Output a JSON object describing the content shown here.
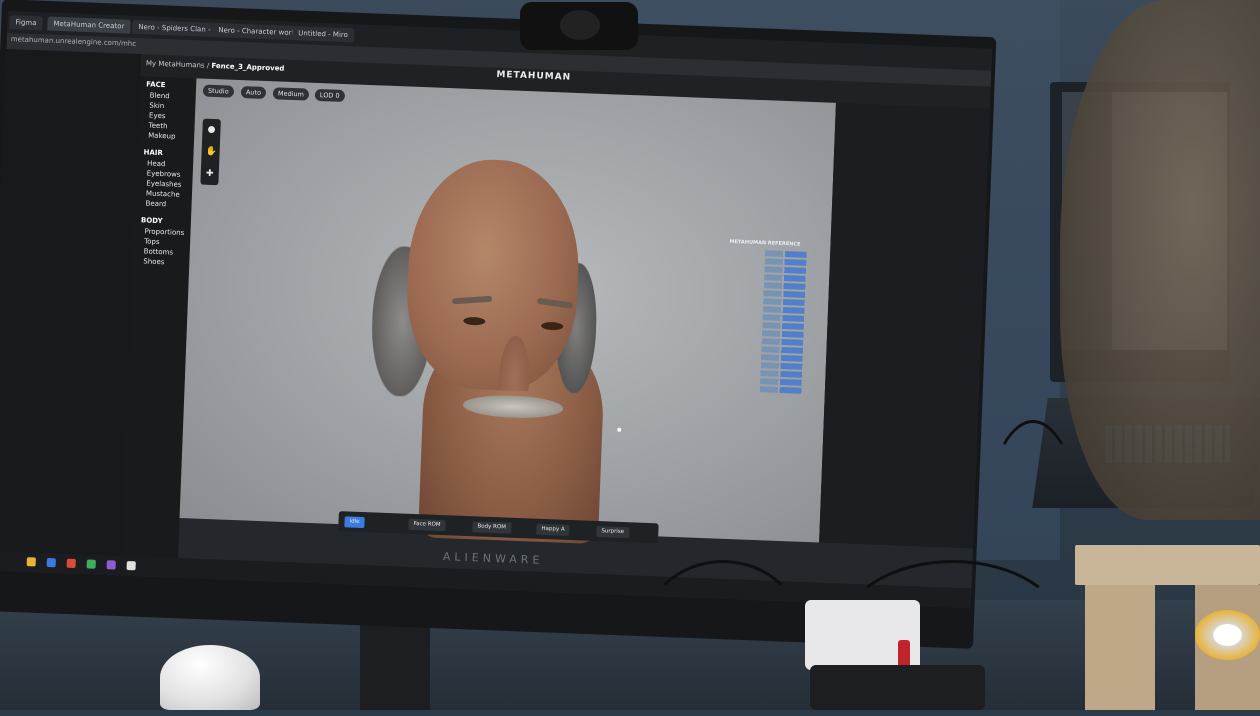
{
  "browser": {
    "tabs": [
      "Figma",
      "MetaHuman Creator",
      "Nero - Spiders Clan - Concep",
      "Nero - Character work - Miro",
      "Untitled - Miro"
    ],
    "url": "metahuman.unrealengine.com/mhc"
  },
  "app": {
    "logo": "METAHUMAN",
    "breadcrumb_root": "My MetaHumans /",
    "breadcrumb_current": "Fence_3_Approved",
    "toolbar": [
      "Studio",
      "Auto",
      "Medium",
      "LOD 0"
    ]
  },
  "sidebar": {
    "sections": [
      {
        "title": "FACE",
        "items": [
          "Blend",
          "Skin",
          "Eyes",
          "Teeth",
          "Makeup"
        ]
      },
      {
        "title": "HAIR",
        "items": [
          "Head",
          "Eyebrows",
          "Eyelashes",
          "Mustache",
          "Beard"
        ]
      },
      {
        "title": "BODY",
        "items": [
          "Proportions",
          "Tops",
          "Bottoms",
          "Shoes"
        ]
      }
    ]
  },
  "viewport": {
    "annotation_title": "METAHUMAN REFERENCE"
  },
  "bottombar": {
    "chips": [
      "Idle",
      "Face ROM",
      "Body ROM",
      "Happy A",
      "Surprise"
    ]
  },
  "monitor": {
    "brand": "ALIENWARE"
  },
  "colors": {
    "accent": "#3b7be0",
    "viewport_bg": "#9c9fa3",
    "panel_bg": "#181a1c"
  }
}
